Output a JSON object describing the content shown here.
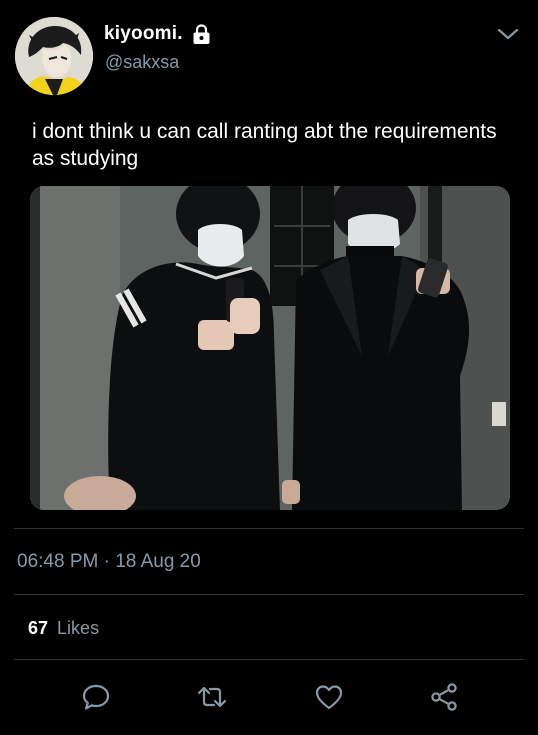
{
  "author": {
    "display_name": "kiyoomi.",
    "handle": "@sakxsa",
    "protected": true
  },
  "tweet": {
    "text": "i dont think u can call ranting abt the requirements as studying",
    "time": "06:48 PM",
    "separator": "·",
    "date": "18 Aug 20"
  },
  "stats": {
    "likes_count": "67",
    "likes_label": "Likes"
  },
  "icons": {
    "lock": "lock-icon",
    "menu": "chevron-down-icon",
    "reply": "reply-icon",
    "retweet": "retweet-icon",
    "like": "heart-icon",
    "share": "share-icon"
  },
  "colors": {
    "background": "#000000",
    "text_primary": "#ffffff",
    "text_secondary": "#8899a6",
    "divider": "#2f3336"
  }
}
